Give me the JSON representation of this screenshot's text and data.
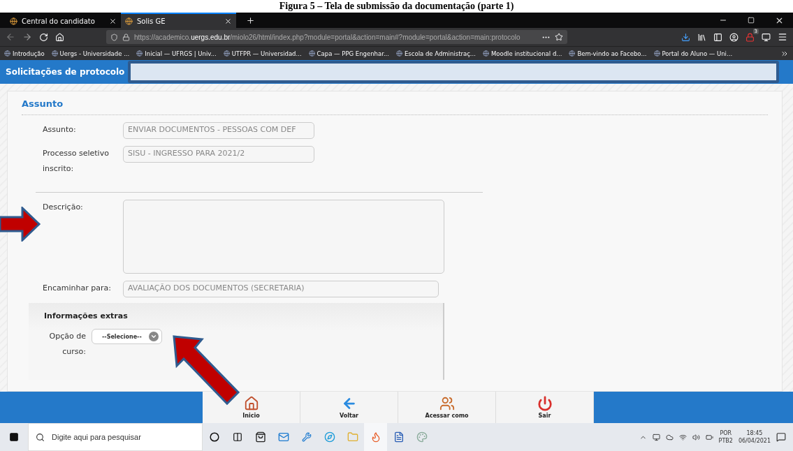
{
  "caption": "Figura 5 – Tela de submissão da documentação (parte 1)",
  "tabs": [
    {
      "label": "Central do candidato",
      "selected": false
    },
    {
      "label": "Solis GE",
      "selected": true
    }
  ],
  "url": {
    "prefix": "https://academico.",
    "domain": "uergs.edu.br",
    "rest": "/miolo26/html/index.php?module=portal&action=main#?module=portal&action=main:protocolo"
  },
  "extension_badge": "3",
  "bookmarks": [
    "Introdução",
    "Uergs - Universidade ...",
    "Inicial — UFRGS | Univ...",
    "UTFPR — Universidad...",
    "Capa — PPG Engenhar...",
    "Escola de Administraç...",
    "Moodle institucional d...",
    "Bem-vindo ao Facebo...",
    "Portal do Aluno — Uni..."
  ],
  "header": {
    "title": "Solicitações de protocolo"
  },
  "section": {
    "title": "Assunto",
    "fields": [
      {
        "kind": "short",
        "label": "Assunto:",
        "value": "ENVIAR DOCUMENTOS - PESSOAS COM DEF"
      },
      {
        "kind": "short",
        "label": "Processo seletivo inscrito:",
        "value": "SISU  - INGRESSO PARA 2021/2"
      },
      {
        "kind": "textarea",
        "label": "Descrição:"
      },
      {
        "kind": "wide",
        "label": "Encaminhar para:",
        "value": "AVALIAÇÃO DOS DOCUMENTOS (SECRETARIA)"
      }
    ]
  },
  "extras": {
    "title": "Informações extras",
    "select_label": "Opção de curso:",
    "select_value": "--Selecione--"
  },
  "toolbar": [
    {
      "kind": "home",
      "label": "Inicio"
    },
    {
      "kind": "back",
      "label": "Voltar"
    },
    {
      "kind": "users",
      "label": "Acessar como"
    },
    {
      "kind": "power",
      "label": "Sair"
    }
  ],
  "taskbar": {
    "search_placeholder": "Digite aqui para pesquisar",
    "language": "POR",
    "layout": "PTB2",
    "time": "18:45",
    "date": "06/04/2021"
  }
}
